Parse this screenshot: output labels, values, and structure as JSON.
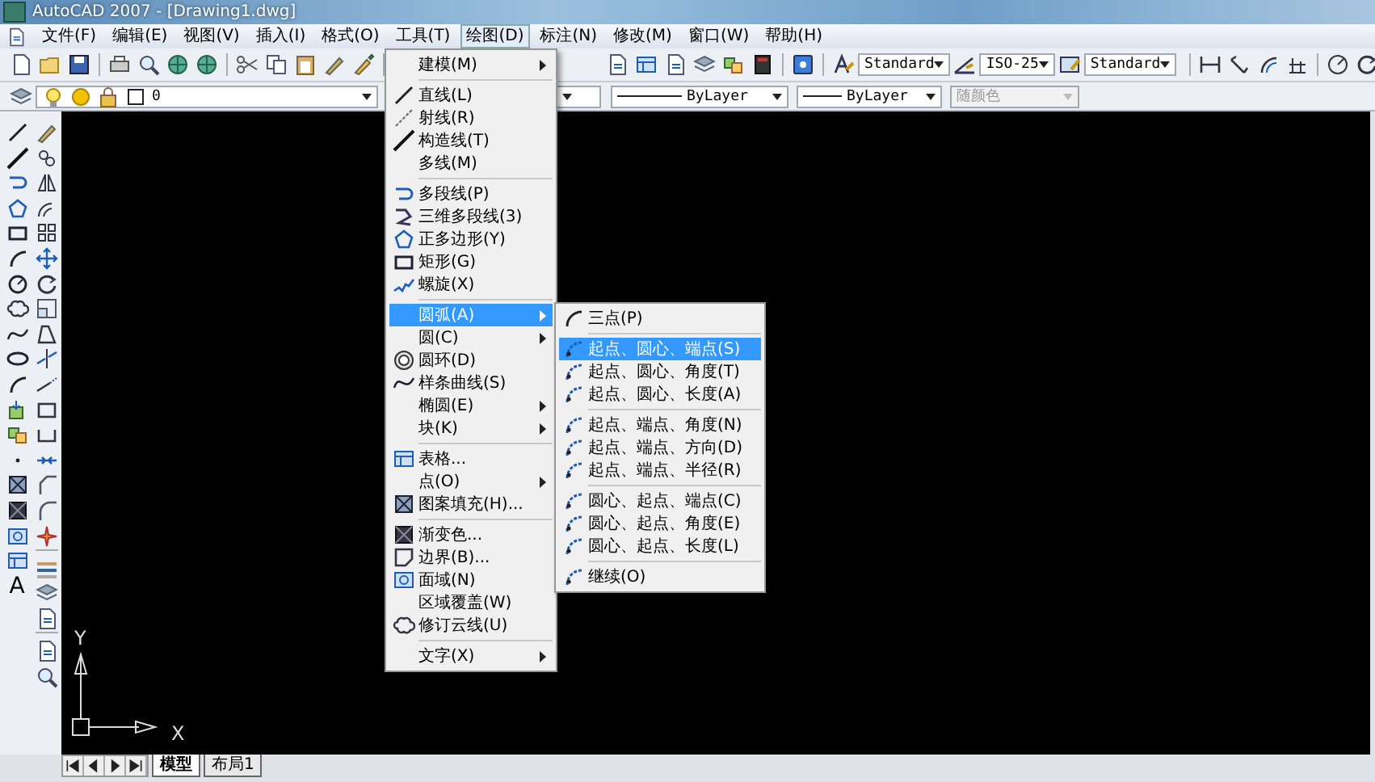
{
  "window": {
    "title": "AutoCAD 2007 - [Drawing1.dwg]"
  },
  "menu_bar": [
    {
      "label": "文件(F)",
      "selected": false
    },
    {
      "label": "编辑(E)",
      "selected": false
    },
    {
      "label": "视图(V)",
      "selected": false
    },
    {
      "label": "插入(I)",
      "selected": false
    },
    {
      "label": "格式(O)",
      "selected": false
    },
    {
      "label": "工具(T)",
      "selected": false
    },
    {
      "label": "绘图(D)",
      "selected": true
    },
    {
      "label": "标注(N)",
      "selected": false
    },
    {
      "label": "修改(M)",
      "selected": false
    },
    {
      "label": "窗口(W)",
      "selected": false
    },
    {
      "label": "帮助(H)",
      "selected": false
    }
  ],
  "toolbar_1": {
    "combos": [
      {
        "value": "Standard"
      },
      {
        "value": "ISO-25"
      },
      {
        "value": "Standard"
      }
    ]
  },
  "toolbar_2": {
    "layer": "0",
    "linetype": "ByLayer",
    "lineweight": "ByLayer",
    "plot_style": {
      "value": "随颜色",
      "disabled": true
    }
  },
  "draw_toolbar": {
    "text_tool": "A"
  },
  "canvas": {
    "x_axis_label": "X",
    "y_axis_label": "Y"
  },
  "layout_tabs": [
    {
      "label": "模型",
      "selected": true
    },
    {
      "label": "布局1",
      "selected": false
    }
  ],
  "draw_menu": {
    "items": [
      {
        "kind": "item",
        "label": "建模(M)",
        "submenu": true,
        "selected": false
      },
      {
        "kind": "separator"
      },
      {
        "kind": "item",
        "label": "直线(L)",
        "submenu": false,
        "selected": false
      },
      {
        "kind": "item",
        "label": "射线(R)",
        "submenu": false,
        "selected": false
      },
      {
        "kind": "item",
        "label": "构造线(T)",
        "submenu": false,
        "selected": false
      },
      {
        "kind": "item",
        "label": "多线(M)",
        "submenu": false,
        "selected": false
      },
      {
        "kind": "separator"
      },
      {
        "kind": "item",
        "label": "多段线(P)",
        "submenu": false,
        "selected": false
      },
      {
        "kind": "item",
        "label": "三维多段线(3)",
        "submenu": false,
        "selected": false
      },
      {
        "kind": "item",
        "label": "正多边形(Y)",
        "submenu": false,
        "selected": false
      },
      {
        "kind": "item",
        "label": "矩形(G)",
        "submenu": false,
        "selected": false
      },
      {
        "kind": "item",
        "label": "螺旋(X)",
        "submenu": false,
        "selected": false
      },
      {
        "kind": "separator"
      },
      {
        "kind": "item",
        "label": "圆弧(A)",
        "submenu": true,
        "selected": true
      },
      {
        "kind": "item",
        "label": "圆(C)",
        "submenu": true,
        "selected": false
      },
      {
        "kind": "item",
        "label": "圆环(D)",
        "submenu": false,
        "selected": false
      },
      {
        "kind": "item",
        "label": "样条曲线(S)",
        "submenu": false,
        "selected": false
      },
      {
        "kind": "item",
        "label": "椭圆(E)",
        "submenu": true,
        "selected": false
      },
      {
        "kind": "item",
        "label": "块(K)",
        "submenu": true,
        "selected": false
      },
      {
        "kind": "separator"
      },
      {
        "kind": "item",
        "label": "表格...",
        "submenu": false,
        "selected": false
      },
      {
        "kind": "item",
        "label": "点(O)",
        "submenu": true,
        "selected": false
      },
      {
        "kind": "item",
        "label": "图案填充(H)...",
        "submenu": false,
        "selected": false
      },
      {
        "kind": "separator"
      },
      {
        "kind": "item",
        "label": "渐变色...",
        "submenu": false,
        "selected": false
      },
      {
        "kind": "item",
        "label": "边界(B)...",
        "submenu": false,
        "selected": false
      },
      {
        "kind": "item",
        "label": "面域(N)",
        "submenu": false,
        "selected": false
      },
      {
        "kind": "item",
        "label": "区域覆盖(W)",
        "submenu": false,
        "selected": false
      },
      {
        "kind": "item",
        "label": "修订云线(U)",
        "submenu": false,
        "selected": false
      },
      {
        "kind": "separator"
      },
      {
        "kind": "item",
        "label": "文字(X)",
        "submenu": true,
        "selected": false
      }
    ]
  },
  "arc_submenu": {
    "items": [
      {
        "kind": "item",
        "label": "三点(P)",
        "selected": false
      },
      {
        "kind": "separator"
      },
      {
        "kind": "item",
        "label": "起点、圆心、端点(S)",
        "selected": true
      },
      {
        "kind": "item",
        "label": "起点、圆心、角度(T)",
        "selected": false
      },
      {
        "kind": "item",
        "label": "起点、圆心、长度(A)",
        "selected": false
      },
      {
        "kind": "separator"
      },
      {
        "kind": "item",
        "label": "起点、端点、角度(N)",
        "selected": false
      },
      {
        "kind": "item",
        "label": "起点、端点、方向(D)",
        "selected": false
      },
      {
        "kind": "item",
        "label": "起点、端点、半径(R)",
        "selected": false
      },
      {
        "kind": "separator"
      },
      {
        "kind": "item",
        "label": "圆心、起点、端点(C)",
        "selected": false
      },
      {
        "kind": "item",
        "label": "圆心、起点、角度(E)",
        "selected": false
      },
      {
        "kind": "item",
        "label": "圆心、起点、长度(L)",
        "selected": false
      },
      {
        "kind": "separator"
      },
      {
        "kind": "item",
        "label": "继续(O)",
        "selected": false
      }
    ]
  }
}
